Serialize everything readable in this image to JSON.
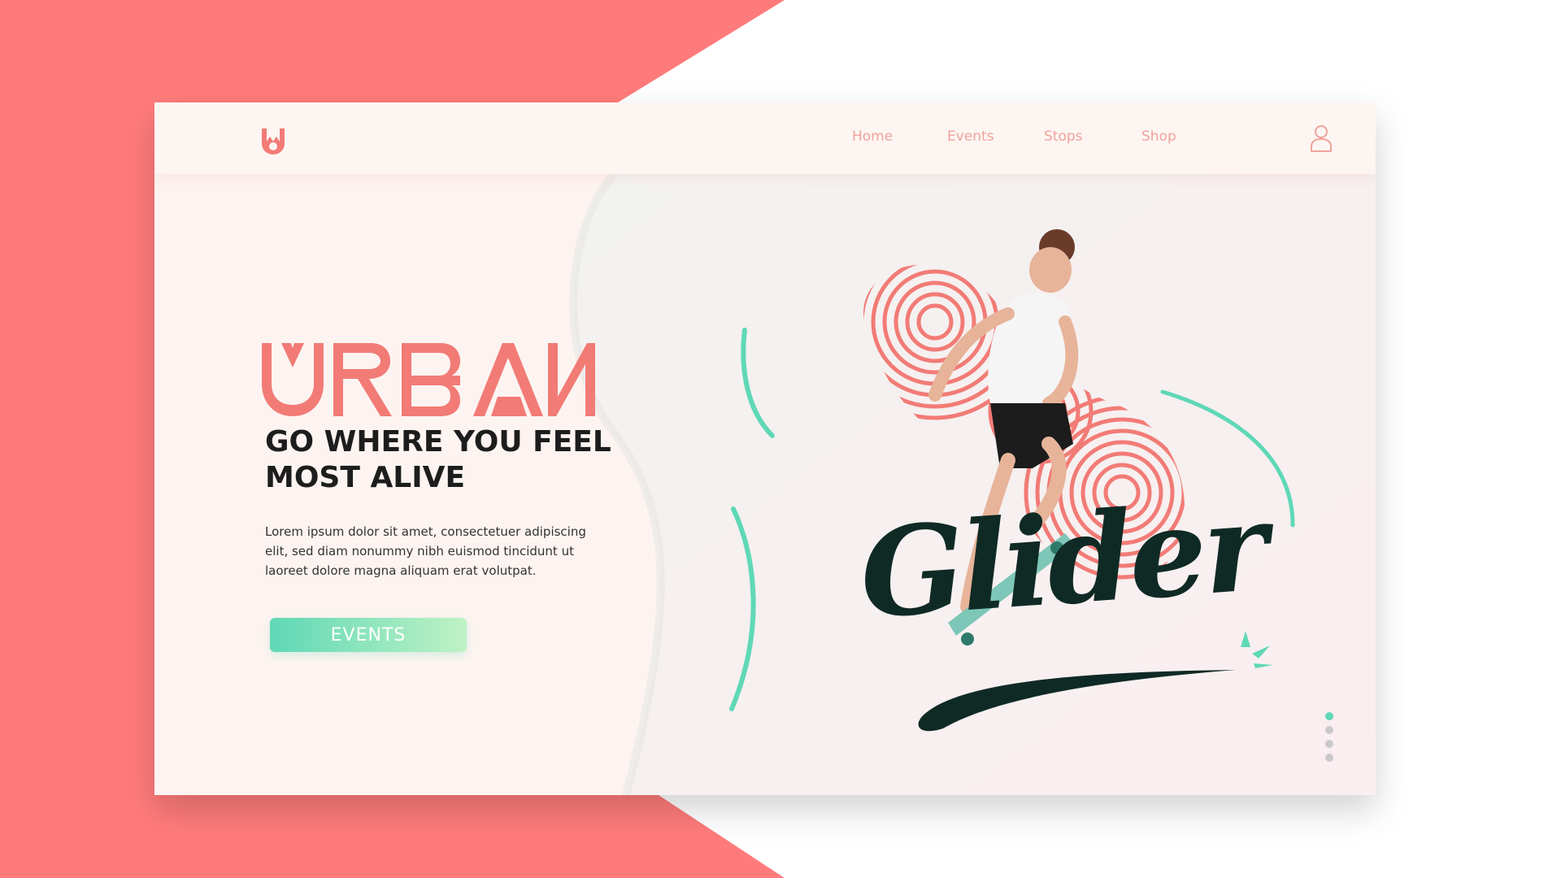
{
  "brand": {
    "logo_letter": "W",
    "wordmark": "URBAN",
    "script_word": "Glider"
  },
  "nav": {
    "items": [
      {
        "label": "Home"
      },
      {
        "label": "Events"
      },
      {
        "label": "Stops"
      },
      {
        "label": "Shop"
      }
    ],
    "user_icon": "user-icon"
  },
  "hero": {
    "headline": "GO WHERE YOU FEEL MOST ALIVE",
    "body": "Lorem ipsum dolor sit amet, consectetuer adipiscing elit, sed diam nonummy nibh euismod tincidunt ut laoreet dolore magna aliquam erat volutpat.",
    "cta_label": "EVENTS"
  },
  "pager": {
    "count": 4,
    "active_index": 0
  },
  "colors": {
    "accent": "#ff7b7b",
    "mint": "#5fd8b6",
    "dark": "#0f2a24",
    "card": "#fdf4f1"
  }
}
